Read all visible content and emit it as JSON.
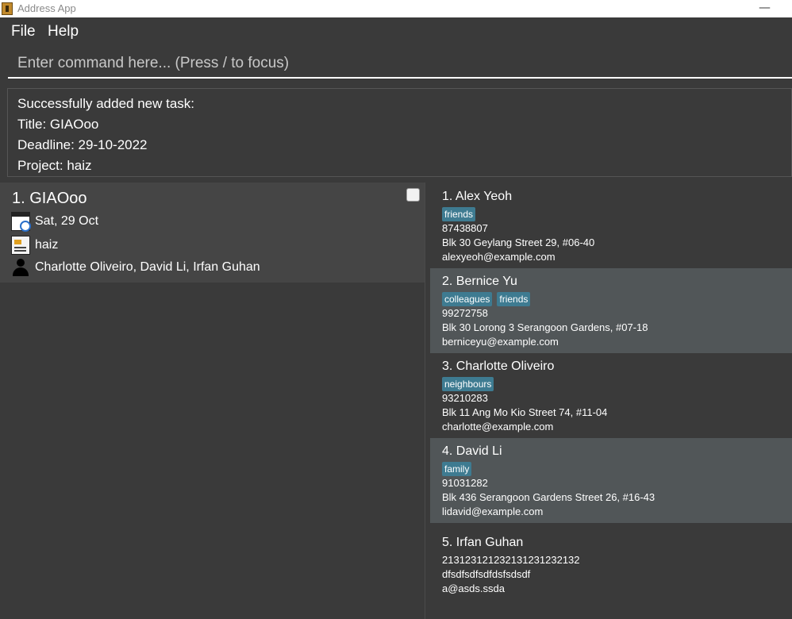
{
  "window": {
    "title": "Address App",
    "minimize": "—"
  },
  "menu": {
    "file": "File",
    "help": "Help"
  },
  "command": {
    "placeholder": "Enter command here... (Press / to focus)"
  },
  "result": {
    "lines": [
      "Successfully added new task:",
      "Title: GIAOoo",
      "Deadline: 29-10-2022",
      "Project: haiz"
    ]
  },
  "task": {
    "title": "1. GIAOoo",
    "deadline": "Sat, 29 Oct",
    "project": "haiz",
    "members": "Charlotte Oliveiro, David Li, Irfan Guhan",
    "done": false
  },
  "persons": [
    {
      "name": "1.  Alex Yeoh",
      "tags": [
        "friends"
      ],
      "phone": "87438807",
      "address": "Blk 30 Geylang Street 29, #06-40",
      "email": "alexyeoh@example.com"
    },
    {
      "name": "2.  Bernice Yu",
      "tags": [
        "colleagues",
        "friends"
      ],
      "phone": "99272758",
      "address": "Blk 30 Lorong 3 Serangoon Gardens, #07-18",
      "email": "berniceyu@example.com"
    },
    {
      "name": "3.  Charlotte Oliveiro",
      "tags": [
        "neighbours"
      ],
      "phone": "93210283",
      "address": "Blk 11 Ang Mo Kio Street 74, #11-04",
      "email": "charlotte@example.com"
    },
    {
      "name": "4.  David Li",
      "tags": [
        "family"
      ],
      "phone": "91031282",
      "address": "Blk 436 Serangoon Gardens Street 26, #16-43",
      "email": "lidavid@example.com"
    },
    {
      "name": "5.  Irfan Guhan",
      "tags": [],
      "phone": "21312312123213123123213​2",
      "address": "dfsdfsdfsdfdsfsdsdf",
      "email": "a@asds.ssda"
    }
  ]
}
